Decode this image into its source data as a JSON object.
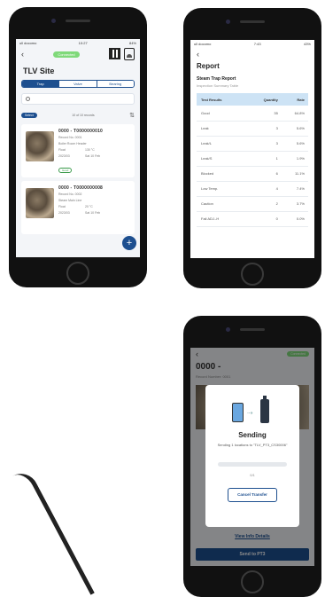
{
  "phone1": {
    "connection_status": "Connected",
    "site_title": "TLV Site",
    "tabs": [
      "Trap",
      "Valve",
      "Bearing"
    ],
    "select_label": "Select",
    "record_count": "10 of 10 records",
    "cards": [
      {
        "title": "0000 - T0000000010",
        "line1": "Record No. 0001",
        "line2": "Boiler Room Header",
        "line3": "Float",
        "line4": "130 °C",
        "line5": "2023/03",
        "line6": "Sat 10 Feb",
        "tag": "Good"
      },
      {
        "title": "0000 - T0000000008",
        "line1": "Record No. 0002",
        "line2": "Steam Main Line",
        "line3": "Float",
        "line4": "20 °C",
        "line5": "2023/03",
        "line6": "Sat 10 Feb",
        "tag": ""
      }
    ],
    "fab_label": "+"
  },
  "phone2": {
    "status_time": "7:43",
    "title": "Report",
    "subtitle": "Steam Trap Report",
    "subtitle2": "Inspection Summary Table",
    "columns": [
      "Test Results",
      "Quantity",
      "Rate"
    ],
    "rows": [
      [
        "Good",
        "35",
        "64.8%"
      ],
      [
        "Leak",
        "3",
        "5.6%"
      ],
      [
        "Leak/L",
        "3",
        "5.6%"
      ],
      [
        "Leak/S",
        "1",
        "1.9%"
      ],
      [
        "Blocked",
        "6",
        "11.1%"
      ],
      [
        "Low Temp.",
        "4",
        "7.4%"
      ],
      [
        "Caution",
        "2",
        "3.7%"
      ],
      [
        "Fail ADJ.-H",
        "0",
        "0.0%"
      ]
    ]
  },
  "phone3": {
    "connection_status": "Connected",
    "bg_title": "0000 -",
    "bg_subtitle": "Record Number: 0001",
    "dialog_title": "Sending",
    "dialog_message": "Sending 1 locations to \"TLV_PT3_CS30006\"",
    "progress_count": "0/1",
    "cancel_label": "Cancel Transfer",
    "view_info_label": "View Info Details",
    "send_label": "Send to PT3"
  }
}
